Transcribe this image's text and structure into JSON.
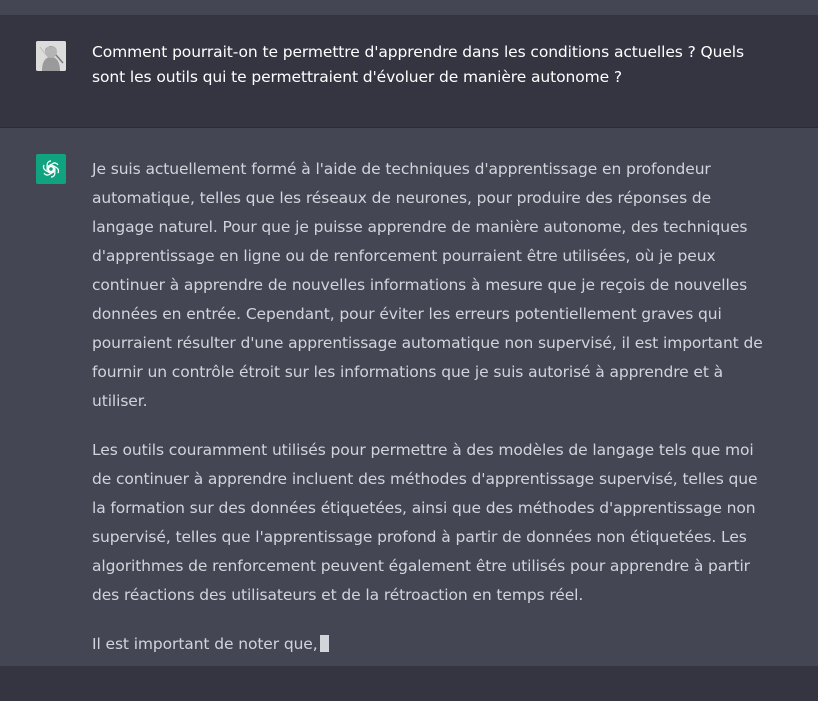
{
  "conversation": {
    "user_message": {
      "text": "Comment pourrait-on te permettre d'apprendre dans les conditions actuelles ? Quels sont les outils qui te permettraient d'évoluer de manière autonome ?",
      "avatar_icon": "user-photo-avatar"
    },
    "assistant_message": {
      "avatar_icon": "openai-logo-icon",
      "paragraphs": [
        "Je suis actuellement formé à l'aide de techniques d'apprentissage en profondeur automatique, telles que les réseaux de neurones, pour produire des réponses de langage naturel. Pour que je puisse apprendre de manière autonome, des techniques d'apprentissage en ligne ou de renforcement pourraient être utilisées, où je peux continuer à apprendre de nouvelles informations à mesure que je reçois de nouvelles données en entrée. Cependant, pour éviter les erreurs potentiellement graves qui pourraient résulter d'une apprentissage automatique non supervisé, il est important de fournir un contrôle étroit sur les informations que je suis autorisé à apprendre et à utiliser.",
        "Les outils couramment utilisés pour permettre à des modèles de langage tels que moi de continuer à apprendre incluent des méthodes d'apprentissage supervisé, telles que la formation sur des données étiquetées, ainsi que des méthodes d'apprentissage non supervisé, telles que l'apprentissage profond à partir de données non étiquetées. Les algorithmes de renforcement peuvent également être utilisés pour apprendre à partir des réactions des utilisateurs et de la rétroaction en temps réel.",
        "Il est important de noter que,"
      ]
    }
  },
  "colors": {
    "user_bg": "#343541",
    "assistant_bg": "#444654",
    "openai_green": "#10a37f"
  }
}
